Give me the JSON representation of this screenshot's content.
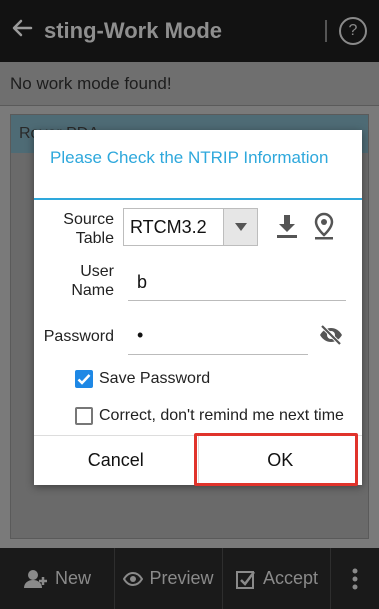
{
  "app": {
    "back_icon": "arrow-left-icon",
    "title": "sting-Work Mode",
    "help_icon": "help-icon",
    "status": "No work mode found!",
    "list_item": "Rover PDA"
  },
  "bottom_bar": {
    "new_label": "New",
    "preview_label": "Preview",
    "accept_label": "Accept",
    "more_icon": "more-vert-icon"
  },
  "dialog": {
    "title": "Please Check the NTRIP Information",
    "source_table_label_line1": "Source",
    "source_table_label_line2": "Table",
    "source_table_value": "RTCM3.2",
    "user_name_label_line1": "User",
    "user_name_label_line2": "Name",
    "user_name_value": "b",
    "password_label": "Password",
    "password_value": "•",
    "save_password_label": "Save Password",
    "save_password_checked": true,
    "dont_remind_label": "Correct, don't remind me next time",
    "dont_remind_checked": false,
    "cancel_label": "Cancel",
    "ok_label": "OK"
  },
  "colors": {
    "accent": "#2ea8dc",
    "checkbox": "#1e88e5",
    "highlight": "#e0332b"
  }
}
